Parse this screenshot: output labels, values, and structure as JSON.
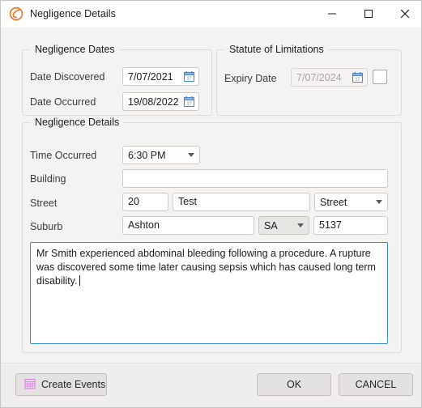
{
  "window": {
    "title": "Negligence Details",
    "icon": "app-logo-icon",
    "controls": {
      "minimize": "minimize-icon",
      "maximize": "maximize-icon",
      "close": "close-icon"
    }
  },
  "groups": {
    "negligence_dates": {
      "title": "Negligence Dates",
      "fields": [
        {
          "label": "Date Discovered",
          "value": "7/07/2021",
          "icon": "calendar-icon",
          "disabled": false
        },
        {
          "label": "Date Occurred",
          "value": "19/08/2022",
          "icon": "calendar-icon",
          "disabled": false
        }
      ]
    },
    "statute_of_limitations": {
      "title": "Statute of Limitations",
      "fields": [
        {
          "label": "Expiry Date",
          "value": "7/07/2024",
          "icon": "calendar-icon",
          "disabled": true
        }
      ],
      "checkbox": {
        "checked": false
      }
    },
    "negligence_details": {
      "title": "Negligence Details",
      "time_occurred": {
        "label": "Time Occurred",
        "value": "6:30 PM"
      },
      "building": {
        "label": "Building",
        "value": "",
        "placeholder": ""
      },
      "street": {
        "label": "Street",
        "number": "20",
        "name": "Test",
        "type": "Street"
      },
      "suburb": {
        "label": "Suburb",
        "name": "Ashton",
        "state": "SA",
        "postcode": "5137"
      },
      "narrative": {
        "value": "Mr Smith experienced abdominal bleeding following a procedure. A rupture was discovered some time later causing sepsis which has caused long term disability."
      }
    }
  },
  "footer": {
    "create_events": {
      "label": "Create Events",
      "icon": "calendar-grid-icon"
    },
    "ok": "OK",
    "cancel": "CANCEL"
  },
  "colors": {
    "accent_logo": "#e8772e",
    "focus_border": "#3b8ad4",
    "calendar_icon": "#4a86c8",
    "events_icon": "#d97fe0",
    "dialog_bg": "#f4f3f1",
    "footer_bg": "#f0eeec"
  }
}
